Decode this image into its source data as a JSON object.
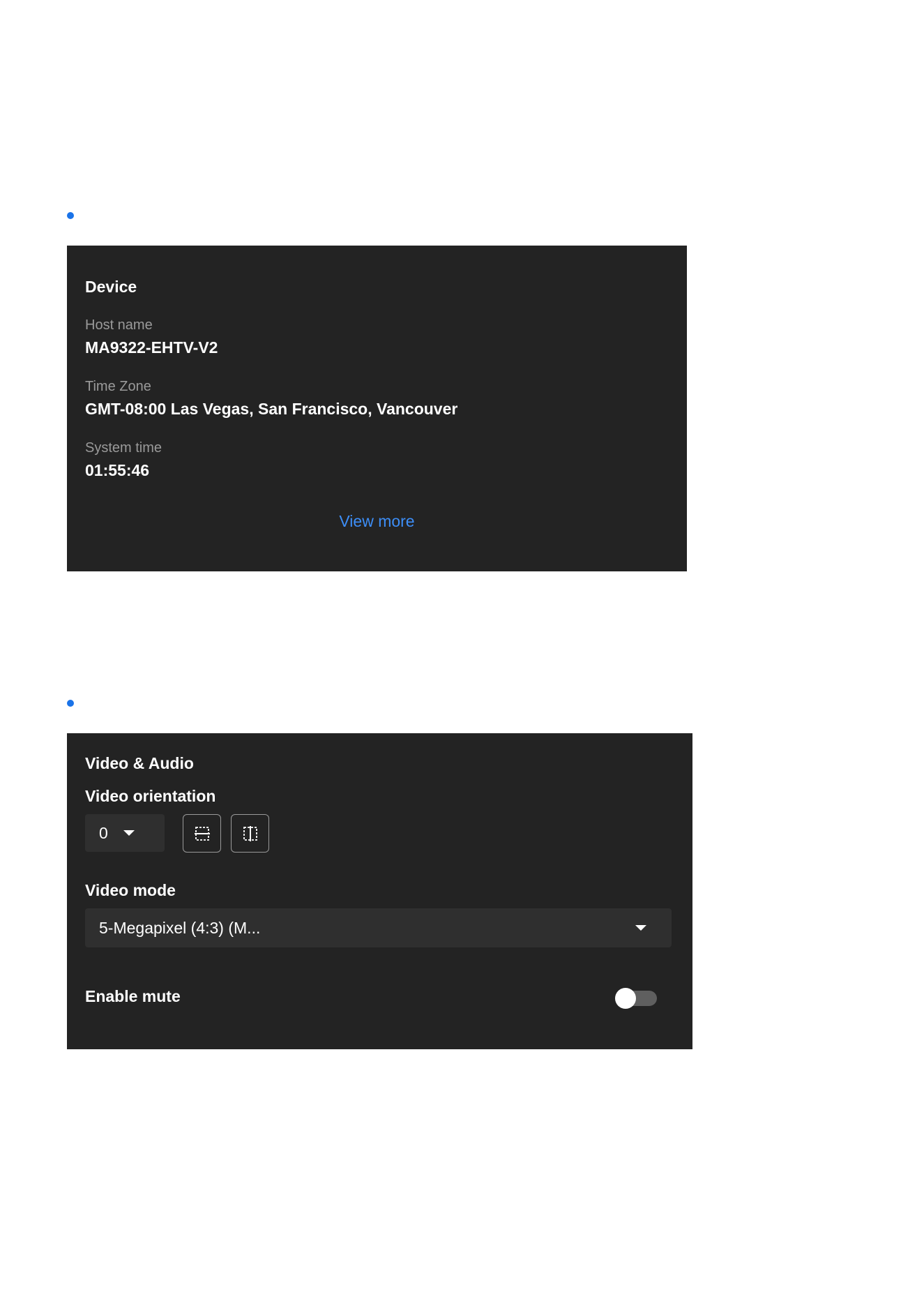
{
  "colors": {
    "accent": "#1a73e8",
    "link": "#3d8ef7",
    "panel_bg": "#232323",
    "muted_text": "#9a9a9a"
  },
  "device": {
    "title": "Device",
    "host_name": {
      "label": "Host name",
      "value": "MA9322-EHTV-V2"
    },
    "time_zone": {
      "label": "Time Zone",
      "value": "GMT-08:00 Las Vegas, San Francisco, Vancouver"
    },
    "system_time": {
      "label": "System time",
      "value": "01:55:46"
    },
    "view_more_label": "View more"
  },
  "video_audio": {
    "title": "Video & Audio",
    "orientation": {
      "label": "Video orientation",
      "selected": "0",
      "flip_vertical_icon": "flip-vertical-icon",
      "flip_horizontal_icon": "flip-horizontal-icon"
    },
    "mode": {
      "label": "Video mode",
      "selected": "5-Megapixel (4:3) (M..."
    },
    "mute": {
      "label": "Enable mute",
      "enabled": false
    }
  }
}
